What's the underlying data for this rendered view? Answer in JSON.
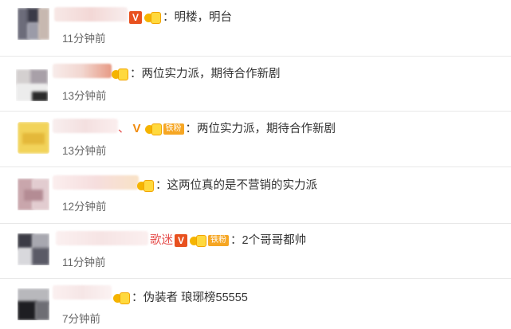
{
  "comments": [
    {
      "prefix": "",
      "v_badge": "V",
      "fan_tag": "",
      "text": "：明楼，明台",
      "time": "11分钟前"
    },
    {
      "prefix": "",
      "v_badge": "",
      "fan_tag": "",
      "text": "：两位实力派，期待合作新剧",
      "time": "13分钟前"
    },
    {
      "prefix": "、",
      "v_badge": "V",
      "fan_tag": "铁粉",
      "text": "：两位实力派，期待合作新剧",
      "time": "13分钟前"
    },
    {
      "prefix": "",
      "v_badge": "",
      "fan_tag": "",
      "text": "：这两位真的是不营销的实力派",
      "time": "12分钟前"
    },
    {
      "prefix": "歌迷",
      "v_badge": "V",
      "fan_tag": "铁粉",
      "text": "：2个哥哥都帅",
      "time": "11分钟前"
    },
    {
      "prefix": "",
      "v_badge": "",
      "fan_tag": "",
      "text": "：伪装者 琅琊榜55555",
      "time": "7分钟前"
    }
  ],
  "icons": {
    "vip": "v-verified-icon",
    "fan": "fan-badge-icon"
  },
  "colors": {
    "v_badge": "#e8511f",
    "fan_tag": "#f6a623",
    "time": "#666666",
    "prefix": "#e6504e"
  }
}
